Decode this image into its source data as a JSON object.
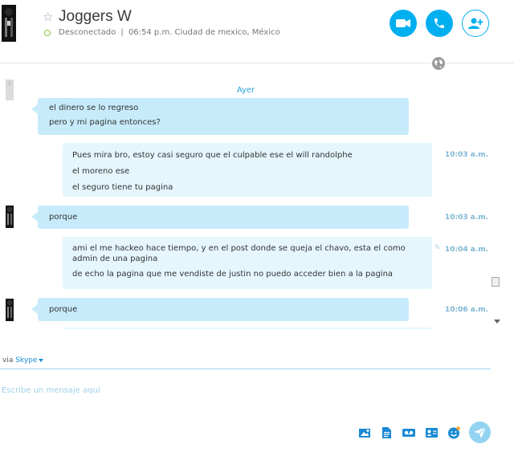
{
  "header": {
    "contact_name": "Joggers W",
    "status": "Desconectado",
    "separator": "|",
    "local_time": "06:54 p.m. Ciudad de mexico, México"
  },
  "conversation": {
    "day_separator": "Ayer",
    "messages": [
      {
        "direction": "incoming",
        "lines": [
          "el dinero se lo regreso",
          "pero y mi pagina entonces?"
        ],
        "time": ""
      },
      {
        "direction": "outgoing",
        "lines": [
          "Pues mira bro, estoy casi seguro que el culpable ese el will randolphe",
          "el moreno ese",
          "el seguro tiene tu pagina"
        ],
        "time": "10:03 a.m."
      },
      {
        "direction": "incoming",
        "lines": [
          "porque"
        ],
        "time": "10:03 a.m."
      },
      {
        "direction": "outgoing",
        "lines": [
          "ami el me hackeo hace tiempo, y en el post donde se queja el chavo, esta el como admin de una pagina",
          "de echo la pagina que me vendiste de justin no puedo acceder bien a la pagina"
        ],
        "time": "10:04 a.m."
      },
      {
        "direction": "incoming",
        "lines": [
          "porque"
        ],
        "time": "10:06 a.m."
      }
    ]
  },
  "composer": {
    "via_label": "via",
    "service": "Skype",
    "placeholder": "Escribe un mensaje aquí"
  },
  "colors": {
    "accent": "#00aff0",
    "incoming_bubble": "#c7ebfb",
    "outgoing_bubble": "#e5f6fd",
    "status_offline": "#8cc63e",
    "timestamp": "#7fb6d3"
  },
  "icons": {
    "favorite": "star-outline-icon",
    "video": "video-camera-icon",
    "call": "phone-icon",
    "add_people": "add-person-icon",
    "globe": "globe-icon",
    "toolbar": [
      "send-photo-icon",
      "send-file-icon",
      "video-message-icon",
      "send-contact-icon",
      "emoticon-icon",
      "send-icon"
    ]
  }
}
